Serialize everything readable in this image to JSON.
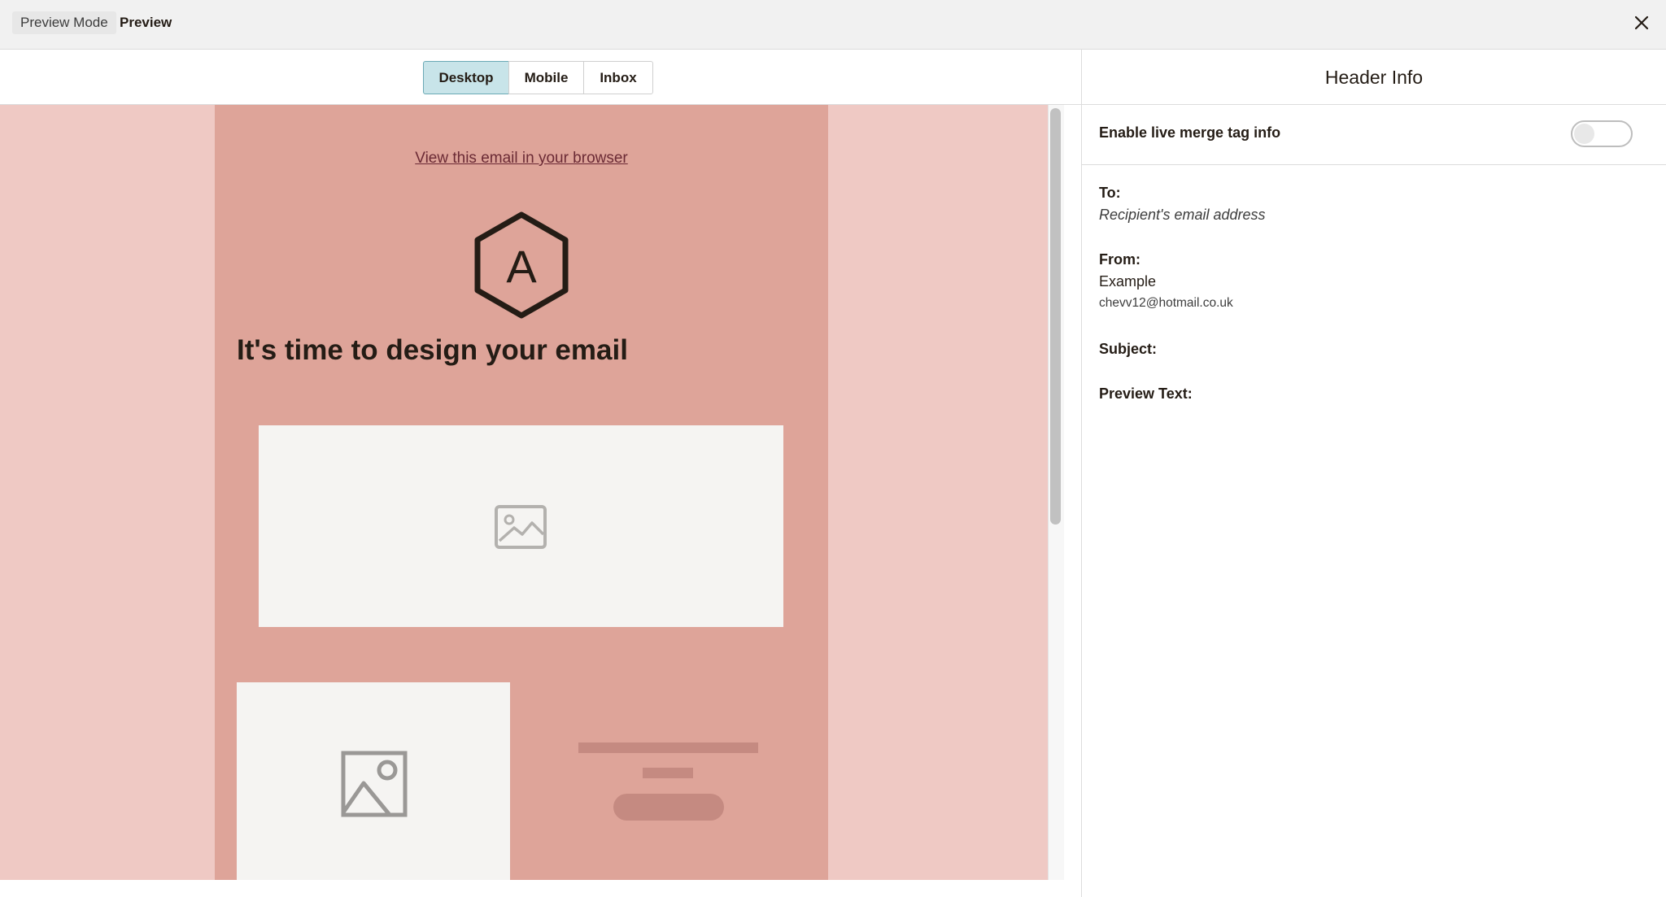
{
  "topbar": {
    "mode_label": "Preview Mode",
    "title": "Preview",
    "close_icon": "close-icon"
  },
  "device_tabs": {
    "desktop": "Desktop",
    "mobile": "Mobile",
    "inbox": "Inbox",
    "active": "Desktop"
  },
  "email": {
    "browser_link": "View this email in your browser",
    "logo_letter": "A",
    "headline": "It's time to design your email",
    "image_icon": "image-placeholder-icon"
  },
  "panel": {
    "title": "Header Info",
    "merge_toggle_label": "Enable live merge tag info",
    "merge_toggle_on": false,
    "to_label": "To:",
    "to_value": "Recipient's email address",
    "from_label": "From:",
    "from_name": "Example",
    "from_email": "chevv12@hotmail.co.uk",
    "subject_label": "Subject:",
    "preview_text_label": "Preview Text:"
  },
  "colors": {
    "page_background": "#efc9c4",
    "email_background": "#dea499",
    "active_tab": "#c8e4e9",
    "link": "#6b2a35"
  }
}
